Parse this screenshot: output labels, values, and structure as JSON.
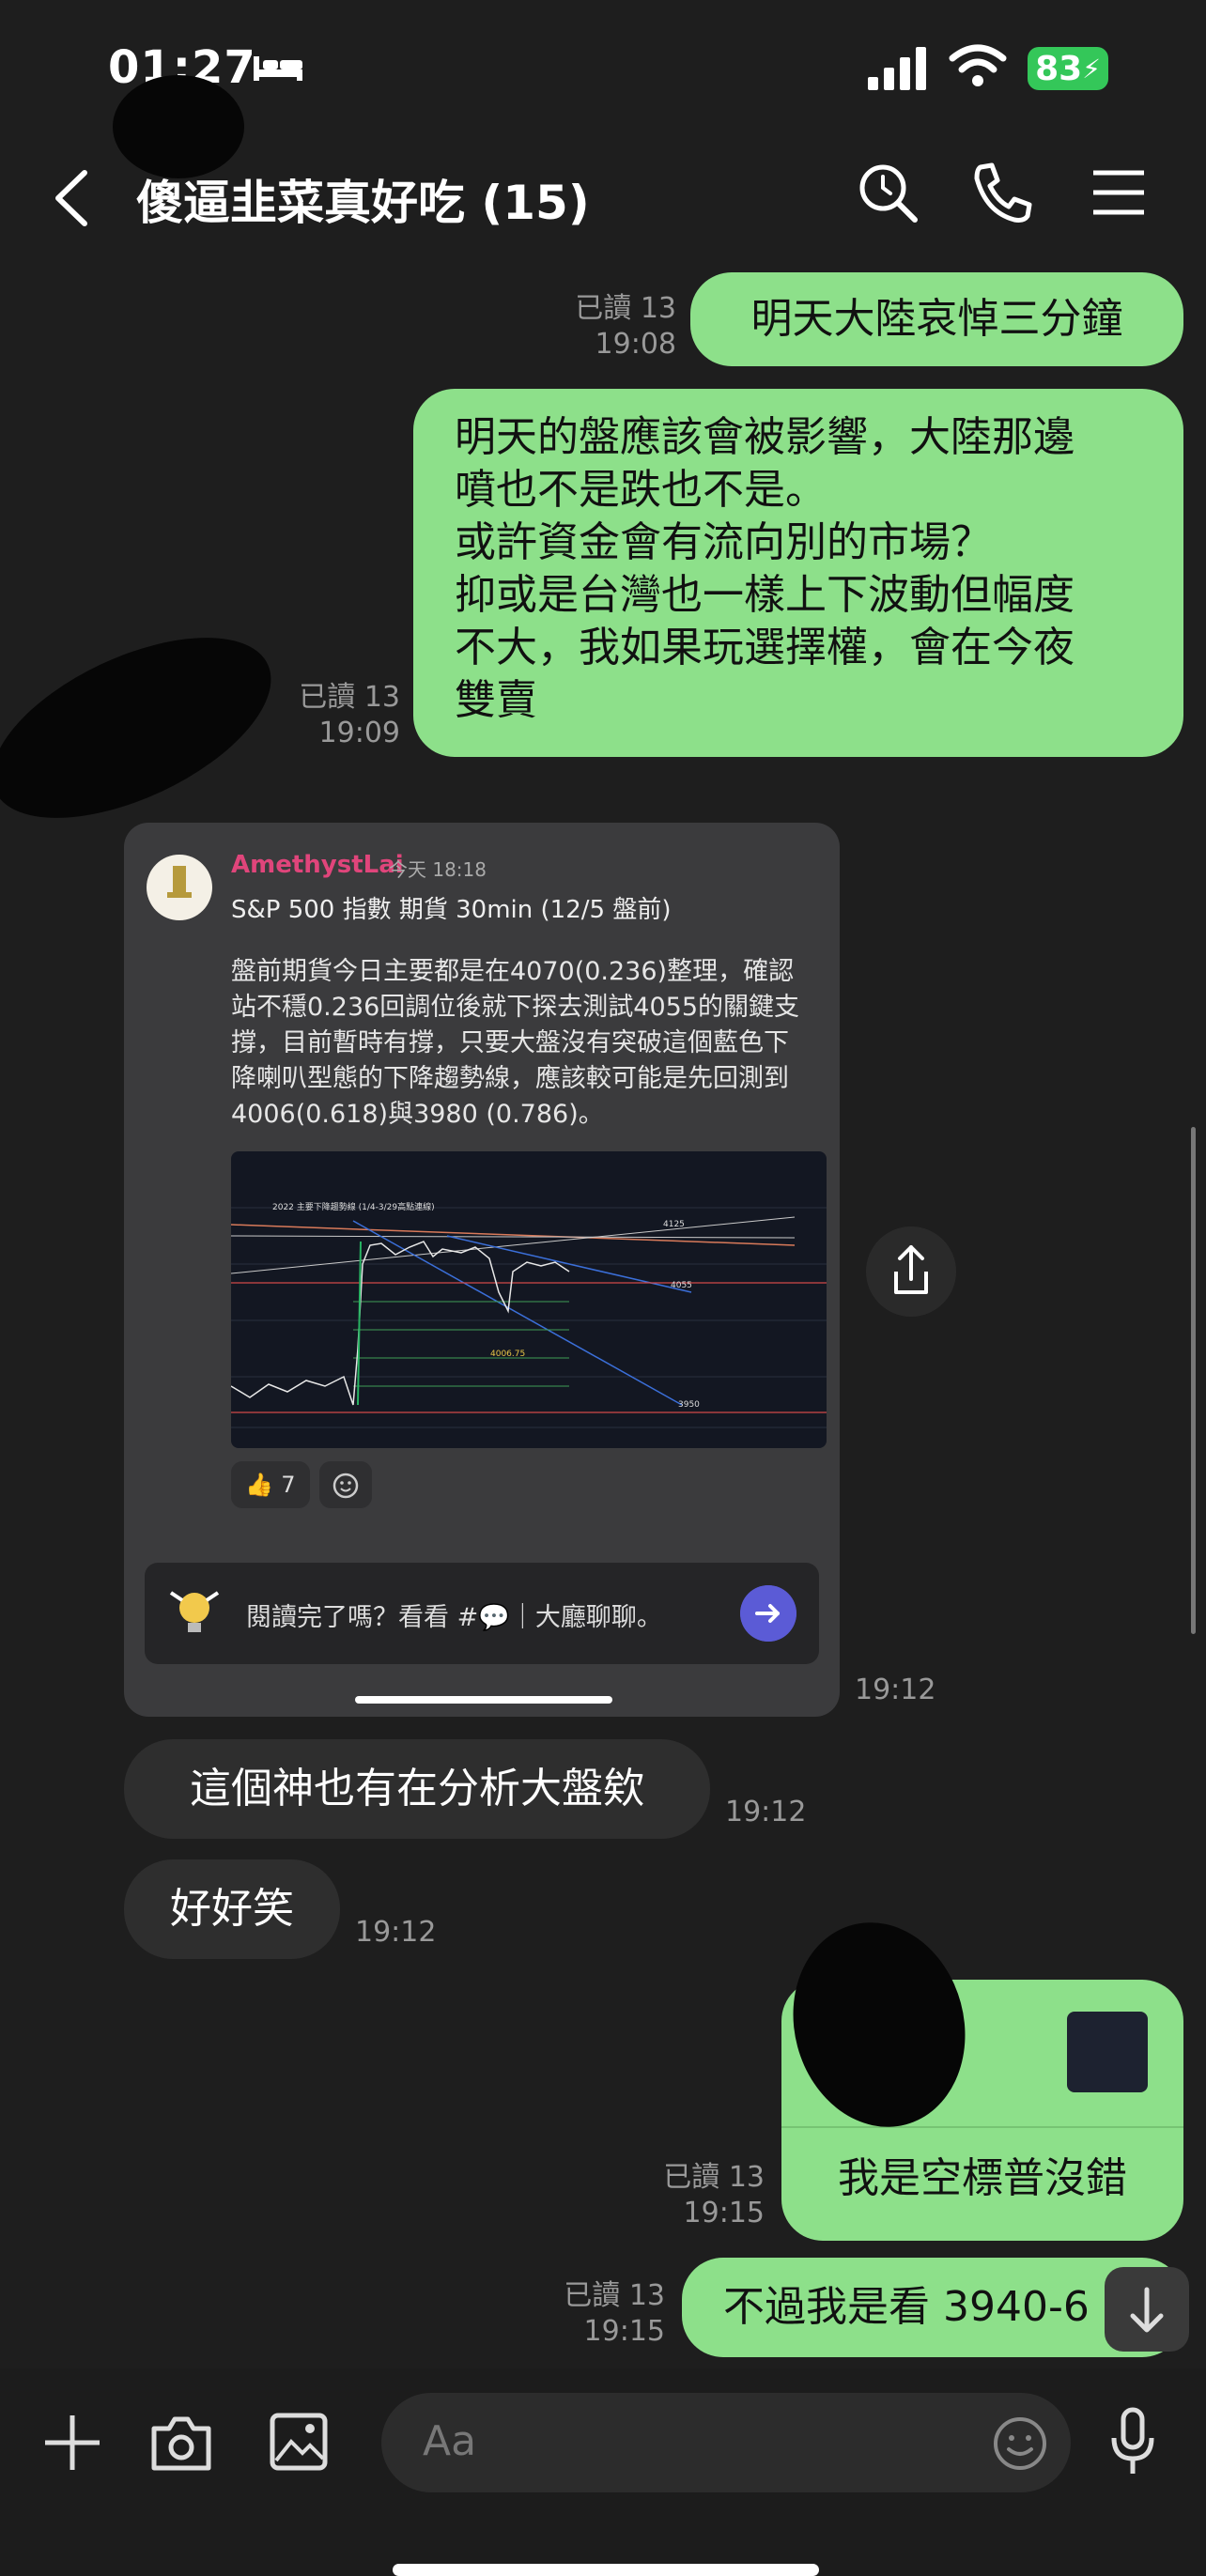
{
  "status_bar": {
    "time": "01:27",
    "battery": "83"
  },
  "header": {
    "title": "傻逼韭菜真好吃 (15)",
    "icons": [
      "search-icon",
      "phone-icon",
      "menu-icon"
    ]
  },
  "messages": [
    {
      "id": "m1",
      "dir": "out",
      "read": "已讀 13",
      "time": "19:08",
      "text": "明天大陸哀悼三分鐘"
    },
    {
      "id": "m2",
      "dir": "out",
      "read": "已讀 13",
      "time": "19:09",
      "lines": [
        "明天的盤應該會被影響，大陸那邊",
        "噴也不是跌也不是。",
        "或許資金會有流向別的市場？",
        "抑或是台灣也一樣上下波動但幅度",
        "不大，我如果玩選擇權，會在今夜",
        "雙賣"
      ]
    },
    {
      "id": "m3",
      "dir": "in",
      "time": "19:12",
      "text": "這個神也有在分析大盤欸"
    },
    {
      "id": "m4",
      "dir": "in",
      "time": "19:12",
      "text": "好好笑"
    },
    {
      "id": "m5",
      "dir": "out",
      "read": "已讀 13",
      "time": "19:15",
      "text": "我是空標普沒錯"
    },
    {
      "id": "m6",
      "dir": "out",
      "read": "已讀 13",
      "time": "19:15",
      "text": "不過我是看 3940-6"
    }
  ],
  "shared_post": {
    "author": "AmethystLai",
    "author_time": "今天 18:18",
    "title": "S&P 500 指數 期貨 30min (12/5 盤前)",
    "body_lines": [
      "盤前期貨今日主要都是在4070(0.236)整理，確認",
      "站不穩0.236回調位後就下探去測試4055的關鍵支",
      "撐，目前暫時有撐，只要大盤沒有突破這個藍色下",
      "降喇叭型態的下降趨勢線，應該較可能是先回測到",
      "4006(0.618)與3980 (0.786)。"
    ],
    "chart_labels": {
      "header": "2022 主要下降趨勢線 (1/4-3/29高點連線)",
      "l1": "4125",
      "l2": "4055",
      "l3": "4006.75",
      "l4": "3950"
    },
    "reaction_count": "7",
    "promo_text": "閱讀完了嗎？看看 #💬｜大廳聊聊。",
    "time": "19:12"
  },
  "composer": {
    "placeholder": "Aa"
  }
}
